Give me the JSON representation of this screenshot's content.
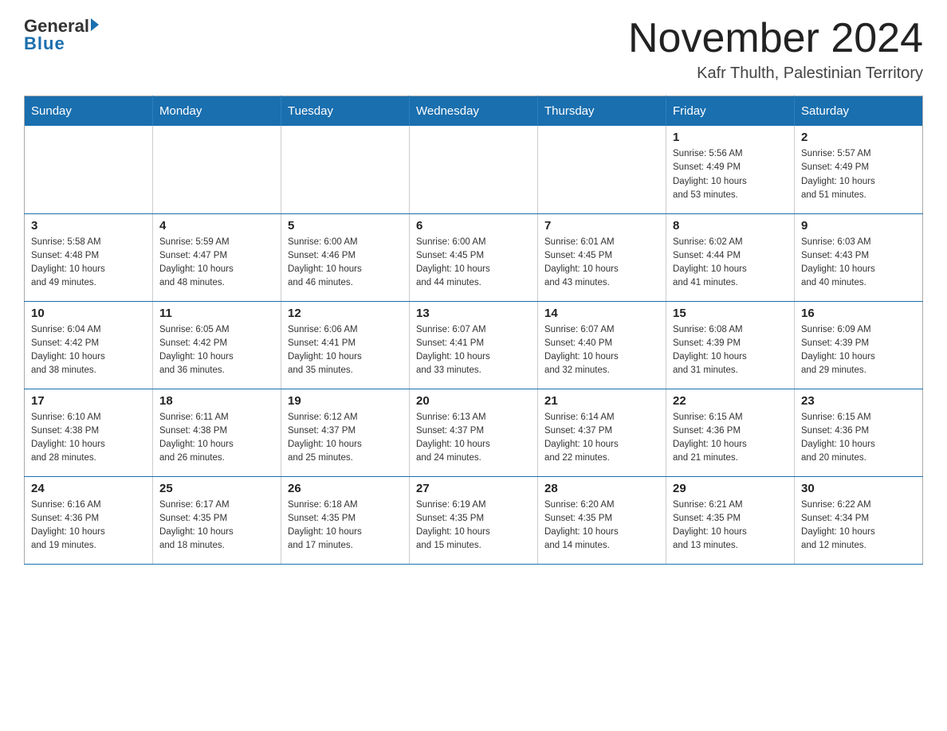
{
  "header": {
    "logo_general": "General",
    "logo_blue": "Blue",
    "title": "November 2024",
    "location": "Kafr Thulth, Palestinian Territory"
  },
  "days_of_week": [
    "Sunday",
    "Monday",
    "Tuesday",
    "Wednesday",
    "Thursday",
    "Friday",
    "Saturday"
  ],
  "weeks": [
    [
      {
        "day": "",
        "info": ""
      },
      {
        "day": "",
        "info": ""
      },
      {
        "day": "",
        "info": ""
      },
      {
        "day": "",
        "info": ""
      },
      {
        "day": "",
        "info": ""
      },
      {
        "day": "1",
        "info": "Sunrise: 5:56 AM\nSunset: 4:49 PM\nDaylight: 10 hours\nand 53 minutes."
      },
      {
        "day": "2",
        "info": "Sunrise: 5:57 AM\nSunset: 4:49 PM\nDaylight: 10 hours\nand 51 minutes."
      }
    ],
    [
      {
        "day": "3",
        "info": "Sunrise: 5:58 AM\nSunset: 4:48 PM\nDaylight: 10 hours\nand 49 minutes."
      },
      {
        "day": "4",
        "info": "Sunrise: 5:59 AM\nSunset: 4:47 PM\nDaylight: 10 hours\nand 48 minutes."
      },
      {
        "day": "5",
        "info": "Sunrise: 6:00 AM\nSunset: 4:46 PM\nDaylight: 10 hours\nand 46 minutes."
      },
      {
        "day": "6",
        "info": "Sunrise: 6:00 AM\nSunset: 4:45 PM\nDaylight: 10 hours\nand 44 minutes."
      },
      {
        "day": "7",
        "info": "Sunrise: 6:01 AM\nSunset: 4:45 PM\nDaylight: 10 hours\nand 43 minutes."
      },
      {
        "day": "8",
        "info": "Sunrise: 6:02 AM\nSunset: 4:44 PM\nDaylight: 10 hours\nand 41 minutes."
      },
      {
        "day": "9",
        "info": "Sunrise: 6:03 AM\nSunset: 4:43 PM\nDaylight: 10 hours\nand 40 minutes."
      }
    ],
    [
      {
        "day": "10",
        "info": "Sunrise: 6:04 AM\nSunset: 4:42 PM\nDaylight: 10 hours\nand 38 minutes."
      },
      {
        "day": "11",
        "info": "Sunrise: 6:05 AM\nSunset: 4:42 PM\nDaylight: 10 hours\nand 36 minutes."
      },
      {
        "day": "12",
        "info": "Sunrise: 6:06 AM\nSunset: 4:41 PM\nDaylight: 10 hours\nand 35 minutes."
      },
      {
        "day": "13",
        "info": "Sunrise: 6:07 AM\nSunset: 4:41 PM\nDaylight: 10 hours\nand 33 minutes."
      },
      {
        "day": "14",
        "info": "Sunrise: 6:07 AM\nSunset: 4:40 PM\nDaylight: 10 hours\nand 32 minutes."
      },
      {
        "day": "15",
        "info": "Sunrise: 6:08 AM\nSunset: 4:39 PM\nDaylight: 10 hours\nand 31 minutes."
      },
      {
        "day": "16",
        "info": "Sunrise: 6:09 AM\nSunset: 4:39 PM\nDaylight: 10 hours\nand 29 minutes."
      }
    ],
    [
      {
        "day": "17",
        "info": "Sunrise: 6:10 AM\nSunset: 4:38 PM\nDaylight: 10 hours\nand 28 minutes."
      },
      {
        "day": "18",
        "info": "Sunrise: 6:11 AM\nSunset: 4:38 PM\nDaylight: 10 hours\nand 26 minutes."
      },
      {
        "day": "19",
        "info": "Sunrise: 6:12 AM\nSunset: 4:37 PM\nDaylight: 10 hours\nand 25 minutes."
      },
      {
        "day": "20",
        "info": "Sunrise: 6:13 AM\nSunset: 4:37 PM\nDaylight: 10 hours\nand 24 minutes."
      },
      {
        "day": "21",
        "info": "Sunrise: 6:14 AM\nSunset: 4:37 PM\nDaylight: 10 hours\nand 22 minutes."
      },
      {
        "day": "22",
        "info": "Sunrise: 6:15 AM\nSunset: 4:36 PM\nDaylight: 10 hours\nand 21 minutes."
      },
      {
        "day": "23",
        "info": "Sunrise: 6:15 AM\nSunset: 4:36 PM\nDaylight: 10 hours\nand 20 minutes."
      }
    ],
    [
      {
        "day": "24",
        "info": "Sunrise: 6:16 AM\nSunset: 4:36 PM\nDaylight: 10 hours\nand 19 minutes."
      },
      {
        "day": "25",
        "info": "Sunrise: 6:17 AM\nSunset: 4:35 PM\nDaylight: 10 hours\nand 18 minutes."
      },
      {
        "day": "26",
        "info": "Sunrise: 6:18 AM\nSunset: 4:35 PM\nDaylight: 10 hours\nand 17 minutes."
      },
      {
        "day": "27",
        "info": "Sunrise: 6:19 AM\nSunset: 4:35 PM\nDaylight: 10 hours\nand 15 minutes."
      },
      {
        "day": "28",
        "info": "Sunrise: 6:20 AM\nSunset: 4:35 PM\nDaylight: 10 hours\nand 14 minutes."
      },
      {
        "day": "29",
        "info": "Sunrise: 6:21 AM\nSunset: 4:35 PM\nDaylight: 10 hours\nand 13 minutes."
      },
      {
        "day": "30",
        "info": "Sunrise: 6:22 AM\nSunset: 4:34 PM\nDaylight: 10 hours\nand 12 minutes."
      }
    ]
  ]
}
